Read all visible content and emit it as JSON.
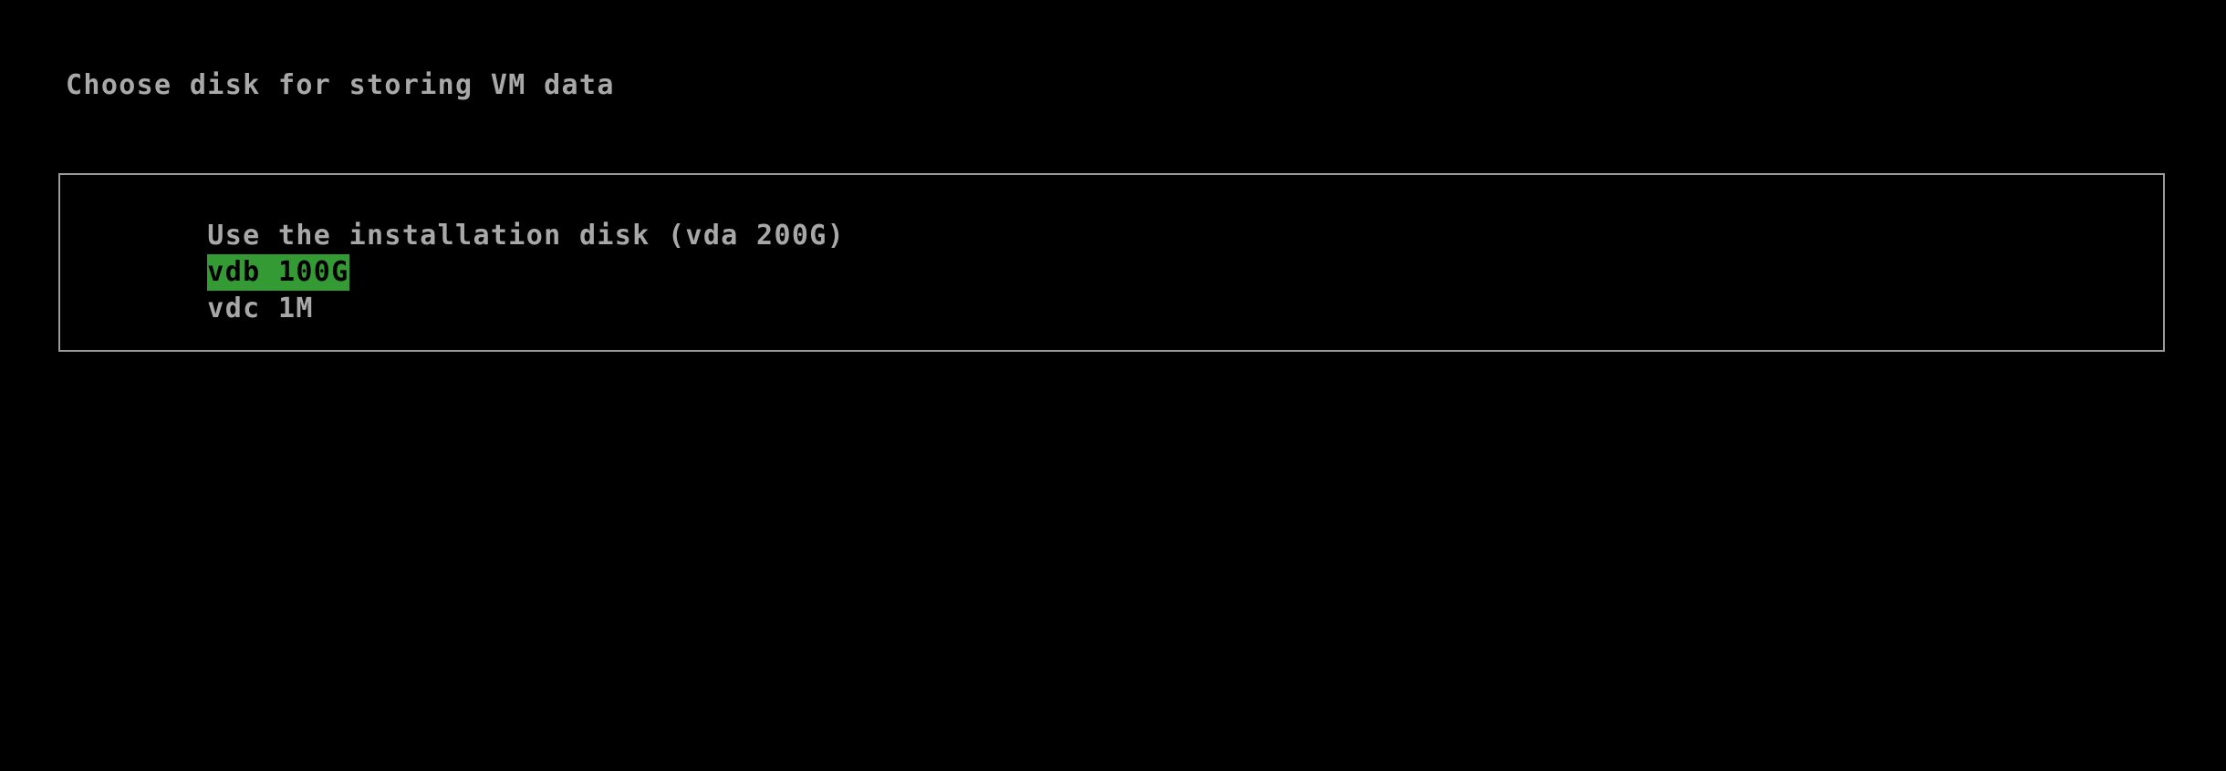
{
  "screen": {
    "background_color": "#000000",
    "foreground_color": "#a8a8a8",
    "highlight_background_color": "#349a34",
    "highlight_foreground_color": "#000000",
    "border_color": "#9a9a9a"
  },
  "prompt": {
    "text": "Choose disk for storing VM data"
  },
  "disk_list": {
    "selected_index": 1,
    "items": [
      {
        "label": "Use the installation disk (vda 200G)",
        "device": "vda",
        "size": "200G",
        "selected": false
      },
      {
        "label": "vdb 100G",
        "device": "vdb",
        "size": "100G",
        "selected": true
      },
      {
        "label": "vdc 1M",
        "device": "vdc",
        "size": "1M",
        "selected": false
      }
    ]
  }
}
